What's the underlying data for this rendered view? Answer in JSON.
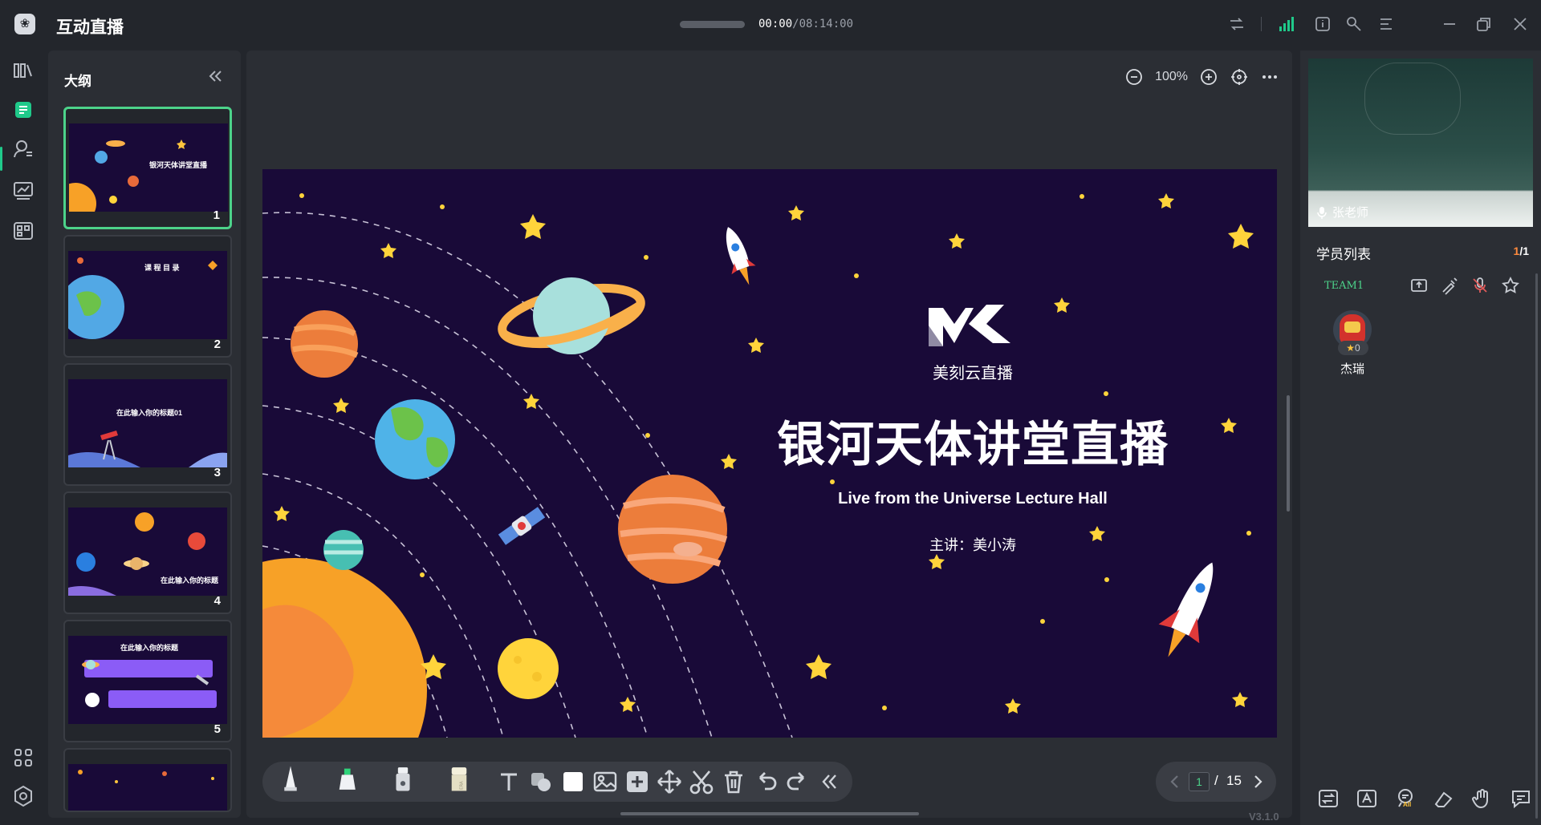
{
  "app": {
    "logo_glyph": "❀",
    "title": "互动直播"
  },
  "playback": {
    "current_time": "00:00",
    "total_time": "/08:14:00"
  },
  "titlebar_icons": [
    "switch-layout-icon",
    "signal-icon",
    "info-icon",
    "tools-icon",
    "menu-icon",
    "minimize-icon",
    "restore-icon",
    "close-icon"
  ],
  "rail": {
    "items": [
      "courseware-icon",
      "outline-icon",
      "students-icon",
      "whiteboard-icon",
      "apps-icon",
      "grid-icon",
      "settings-icon"
    ]
  },
  "outline": {
    "title": "大纲",
    "thumbnails": [
      {
        "num": "1",
        "title": "银河天体讲堂直播"
      },
      {
        "num": "2",
        "title": "课 程 目 录"
      },
      {
        "num": "3",
        "title": "在此输入你的标题01"
      },
      {
        "num": "4",
        "title": "在此输入你的标题"
      },
      {
        "num": "5",
        "title": "在此输入你的标题"
      }
    ]
  },
  "zoom": {
    "level": "100%"
  },
  "slide": {
    "brand": "美刻云直播",
    "title": "银河天体讲堂直播",
    "subtitle": "Live from the Universe Lecture Hall",
    "speaker": "主讲：美小涛"
  },
  "tools": [
    "pen-tool",
    "highlighter-tool",
    "marker-tool",
    "eraser-tool",
    "text-tool",
    "shape-tool",
    "color-tool",
    "image-tool",
    "add-tool",
    "move-tool",
    "cut-tool",
    "delete-tool",
    "undo-tool",
    "redo-tool",
    "collapse-tool"
  ],
  "pager": {
    "current": "1",
    "separator": "/",
    "total": "15"
  },
  "version": "V3.1.0",
  "teacher": {
    "name": "张老师"
  },
  "students": {
    "title": "学员列表",
    "count_current": "1",
    "count_total": "/1",
    "team": "TEAM1",
    "list": [
      {
        "name": "杰瑞",
        "stars": "0"
      }
    ]
  },
  "right_bottom_icons": [
    "switch-icon",
    "text-recognition-icon",
    "all-mute-icon",
    "clear-icon",
    "raise-hand-icon",
    "chat-icon"
  ],
  "right_bottom_badge": "All",
  "colors": {
    "accent_green": "#4cd38a",
    "slide_bg": "#190a38",
    "star": "#ffc53d",
    "count_orange": "#ff8a3d"
  }
}
